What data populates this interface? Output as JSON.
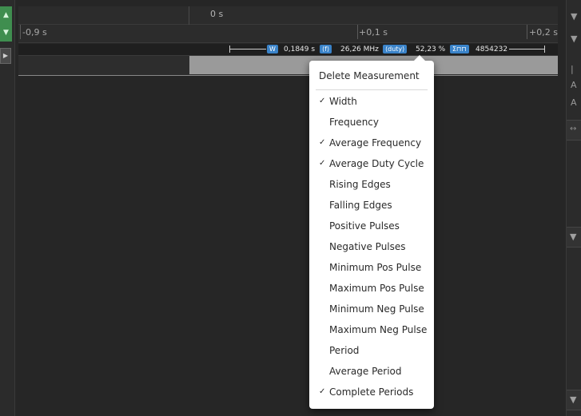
{
  "ruler": {
    "time_label": "0 s",
    "offset_ticks": [
      "-0,9 s",
      "+0,1 s",
      "+0,2 s"
    ]
  },
  "measurement": {
    "width_badge": "W",
    "width_value": "0,1849 s",
    "freq_badge": "⟨f⟩",
    "freq_value": "26,26 MHz",
    "duty_badge": "⟨duty⟩",
    "duty_value": "52,23 %",
    "periods_badge": "Σ⊓⊓",
    "periods_value": "4854232"
  },
  "colors": {
    "accent": "#3a83c9",
    "green_button": "#3f8e4f",
    "background": "#262626",
    "signal_high": "#9a9a9a"
  },
  "context_menu": {
    "delete_label": "Delete Measurement",
    "items": [
      {
        "label": "Width",
        "checked": true
      },
      {
        "label": "Frequency",
        "checked": false
      },
      {
        "label": "Average Frequency",
        "checked": true
      },
      {
        "label": "Average Duty Cycle",
        "checked": true
      },
      {
        "label": "Rising Edges",
        "checked": false
      },
      {
        "label": "Falling Edges",
        "checked": false
      },
      {
        "label": "Positive Pulses",
        "checked": false
      },
      {
        "label": "Negative Pulses",
        "checked": false
      },
      {
        "label": "Minimum Pos Pulse",
        "checked": false
      },
      {
        "label": "Maximum Pos Pulse",
        "checked": false
      },
      {
        "label": "Minimum Neg Pulse",
        "checked": false
      },
      {
        "label": "Maximum Neg Pulse",
        "checked": false
      },
      {
        "label": "Period",
        "checked": false
      },
      {
        "label": "Average Period",
        "checked": false
      },
      {
        "label": "Complete Periods",
        "checked": true
      }
    ],
    "check_glyph": "✓"
  },
  "right_panel": {
    "glyph_pin": "▼",
    "glyph_a1": "A",
    "glyph_a2": "A",
    "glyph_sep": "|"
  }
}
